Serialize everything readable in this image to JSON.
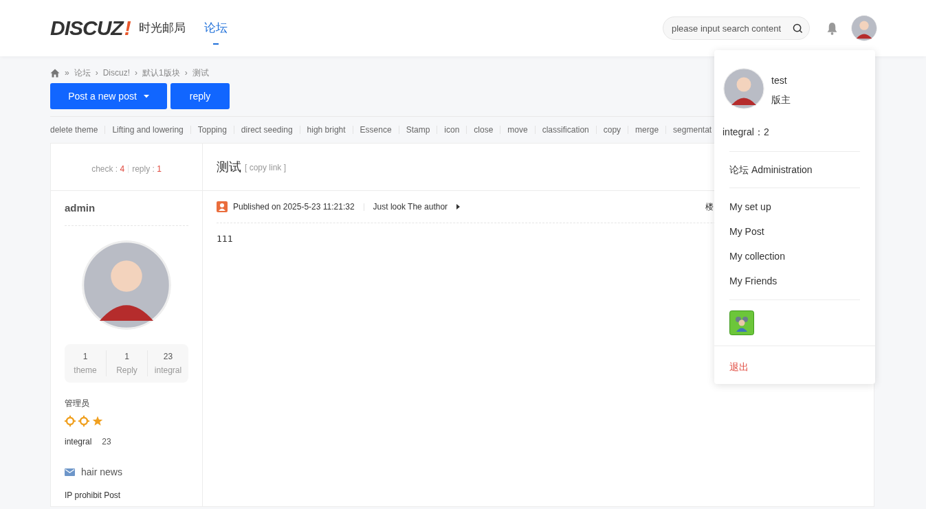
{
  "header": {
    "logo": {
      "text": "DISCUZ",
      "mark": "!"
    },
    "nav": [
      {
        "label": "时光邮局",
        "selected": false
      },
      {
        "label": "论坛",
        "selected": true
      }
    ],
    "search": {
      "placeholder": "please input search content"
    }
  },
  "breadcrumb": [
    {
      "sep": "»",
      "label": "论坛"
    },
    {
      "sep": "›",
      "label": "Discuz!"
    },
    {
      "sep": "›",
      "label": "默认1版块"
    },
    {
      "sep": "›",
      "label": "测试"
    }
  ],
  "buttons": [
    {
      "label": "Post a new post",
      "dropdown": true
    },
    {
      "label": "reply",
      "dropdown": false
    }
  ],
  "mod_actions": [
    "delete theme",
    "Lifting and lowering",
    "Topping",
    "direct seeding",
    "high bright",
    "Essence",
    "Stamp",
    "icon",
    "close",
    "move",
    "classification",
    "copy",
    "merge",
    "segmentat"
  ],
  "thread": {
    "stats": [
      {
        "label": "check :",
        "value": "4"
      },
      {
        "label": "reply :",
        "value": "1"
      }
    ],
    "title": "测试",
    "copy_link": "[ copy link ]"
  },
  "post": {
    "author": "admin",
    "author_stats": [
      {
        "value": "1",
        "label": "theme"
      },
      {
        "value": "1",
        "label": "Reply"
      },
      {
        "value": "23",
        "label": "integral"
      }
    ],
    "group": "管理员",
    "rank_icons": [
      {
        "kind": "sun"
      },
      {
        "kind": "sun"
      },
      {
        "kind": "star"
      }
    ],
    "integral": {
      "label": "integral",
      "value": "23"
    },
    "message_link": "hair news",
    "ip_ban": "IP prohibit Post",
    "published": "Published on 2025-5-23 11:21:32",
    "only_author": "Just look The author",
    "floor": "楼",
    "body": "111"
  },
  "user_menu": {
    "username": "test",
    "role": "版主",
    "integral": "integral：2",
    "admin_link": "论坛 Administration",
    "links": [
      "My set up",
      "My Post",
      "My collection",
      "My Friends"
    ],
    "logout": "退出"
  }
}
